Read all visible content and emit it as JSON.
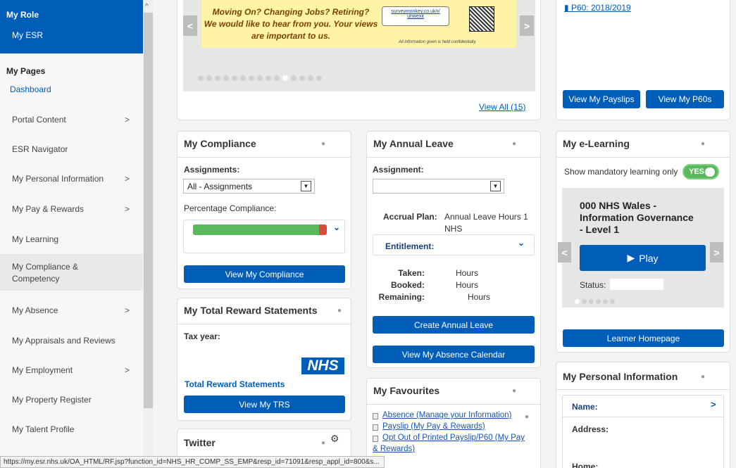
{
  "sidebar": {
    "role_heading": "My Role",
    "role_item": "My ESR",
    "my_pages": "My Pages",
    "dashboard": "Dashboard",
    "items": [
      {
        "label": "Portal Content",
        "chevron": true
      },
      {
        "label": "ESR Navigator",
        "chevron": false
      },
      {
        "label": "My Personal Information",
        "chevron": true
      },
      {
        "label": "My Pay & Rewards",
        "chevron": true
      },
      {
        "label": "My Learning",
        "chevron": false
      },
      {
        "label": "My Compliance &",
        "label2": "Competency",
        "chevron": false,
        "active": true
      },
      {
        "label": "My Absence",
        "chevron": true
      },
      {
        "label": "My Appraisals and Reviews",
        "chevron": false
      },
      {
        "label": "My Employment",
        "chevron": true
      },
      {
        "label": "My Property Register",
        "chevron": false
      },
      {
        "label": "My Talent Profile",
        "chevron": false
      }
    ]
  },
  "banner": {
    "line1": "Moving On? Changing Jobs? Retiring?",
    "line2": "We would like to hear from you. Your views",
    "line3": "are important to us.",
    "url1": "surveymonkey.co.uk/r/",
    "url2": "uhwexit",
    "note": "All information given is held confidentially.",
    "view_all": "View All (15)"
  },
  "payslips": {
    "p60_link": "P60: 2018/2019",
    "btn_payslips": "View My Payslips",
    "btn_p60s": "View My P60s"
  },
  "compliance": {
    "title": "My Compliance",
    "assignments_label": "Assignments:",
    "assignments_value": "All - Assignments",
    "pct_label": "Percentage Compliance:",
    "pct_value": 0.94,
    "btn": "View My Compliance"
  },
  "leave": {
    "title": "My Annual Leave",
    "assignment_label": "Assignment:",
    "accrual_label": "Accrual Plan:",
    "accrual_value1": "Annual Leave Hours 1",
    "accrual_value2": "NHS",
    "entitlement": "Entitlement:",
    "taken": "Taken:",
    "booked": "Booked:",
    "remaining": "Remaining:",
    "hours": "Hours",
    "btn_create": "Create Annual Leave",
    "btn_calendar": "View My Absence Calendar"
  },
  "elearning": {
    "title": "My e-Learning",
    "mandatory": "Show mandatory learning only",
    "toggle": "YES",
    "course1": "000 NHS Wales -",
    "course2": "Information Governance",
    "course3": "- Level 1",
    "play": "Play",
    "status": "Status:",
    "btn": "Learner Homepage"
  },
  "trs": {
    "title": "My Total Reward Statements",
    "tax_year": "Tax year:",
    "logo": "NHS",
    "trs_heading": "Total Reward Statements",
    "btn": "View My TRS"
  },
  "favourites": {
    "title": "My Favourites",
    "items": [
      "Absence (Manage your Information)",
      "Payslip (My Pay & Rewards)",
      "Opt Out of Printed Payslip/P60 (My Pay",
      "& Rewards)"
    ]
  },
  "personal": {
    "title": "My Personal Information",
    "name": "Name:",
    "address": "Address:",
    "home": "Home:"
  },
  "twitter": {
    "title": "Twitter"
  },
  "statusbar": "https://my.esr.nhs.uk/OA_HTML/RF.jsp?function_id=NHS_HR_COMP_SS_EMP&resp_id=71091&resp_appl_id=800&s..."
}
